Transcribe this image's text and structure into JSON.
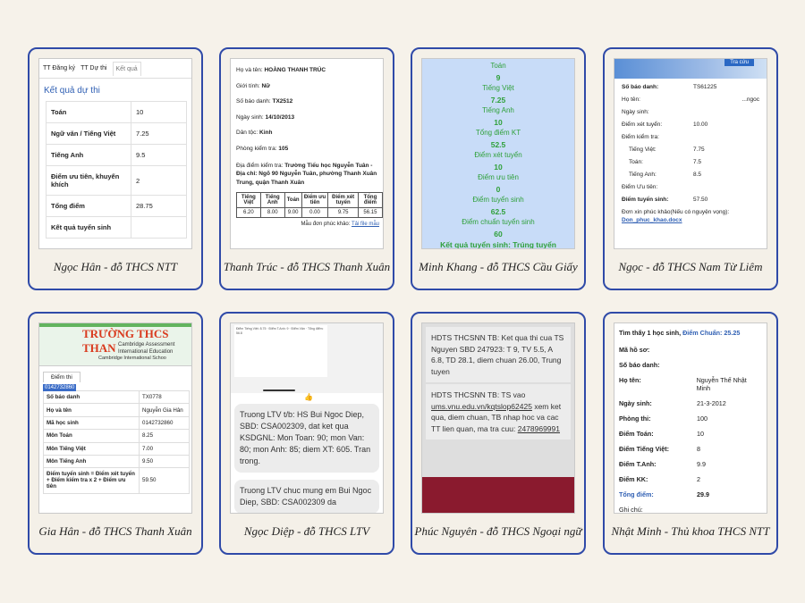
{
  "cards": [
    {
      "caption": "Ngọc Hân - đỗ THCS NTT",
      "tabs": [
        "TT Đăng ký",
        "TT Dự thi",
        "Kết quả"
      ],
      "title": "Kết quả dự thi",
      "rows": [
        {
          "label": "Toán",
          "value": "10"
        },
        {
          "label": "Ngữ văn / Tiếng Việt",
          "value": "7.25"
        },
        {
          "label": "Tiếng Anh",
          "value": "9.5"
        },
        {
          "label": "Điểm ưu tiên, khuyến khích",
          "value": "2"
        },
        {
          "label": "Tổng điểm",
          "value": "28.75"
        },
        {
          "label": "Kết quả tuyển sinh",
          "value": ""
        }
      ]
    },
    {
      "caption": "Thanh Trúc - đỗ THCS Thanh Xuân",
      "lines": [
        {
          "label": "Họ và tên:",
          "value": "HOÀNG THANH TRÚC"
        },
        {
          "label": "Giới tính:",
          "value": "Nữ"
        },
        {
          "label": "Số báo danh:",
          "value": "TX2512"
        },
        {
          "label": "Ngày sinh:",
          "value": "14/10/2013"
        },
        {
          "label": "Dân tộc:",
          "value": "Kinh"
        },
        {
          "label": "Phòng kiểm tra:",
          "value": "105"
        }
      ],
      "address_label": "Địa điểm kiểm tra:",
      "address_value": "Trường Tiểu học Nguyễn Tuân - Địa chỉ: Ngõ 90 Nguyễn Tuân, phường Thanh Xuân Trung, quận Thanh Xuân",
      "table_headers": [
        "Tiếng Việt",
        "Tiếng Anh",
        "Toán",
        "Điểm ưu tiên",
        "Điểm xét tuyển",
        "Tổng điểm"
      ],
      "table_values": [
        "6.20",
        "8.00",
        "9.00",
        "0.00",
        "9.75",
        "56.15"
      ],
      "note_label": "Mẫu đơn phúc khảo:",
      "note_link": "Tải file mẫu"
    },
    {
      "caption": "Minh Khang - đỗ THCS Cầu Giấy",
      "items": [
        {
          "label": "Toán",
          "value": "9"
        },
        {
          "label": "Tiếng Việt",
          "value": "7.25"
        },
        {
          "label": "Tiếng Anh",
          "value": "10"
        },
        {
          "label": "Tổng điểm KT",
          "value": "52.5"
        },
        {
          "label": "Điểm xét tuyển",
          "value": "10"
        },
        {
          "label": "Điểm ưu tiên",
          "value": "0"
        },
        {
          "label": "Điểm tuyển sinh",
          "value": "62.5"
        },
        {
          "label": "Điểm chuẩn tuyển sinh",
          "value": "60"
        }
      ],
      "result": "Kết quả tuyển sinh: Trúng tuyển"
    },
    {
      "caption": "Ngọc - đỗ THCS Nam Từ Liêm",
      "header_button": "Tra cứu",
      "sbd_label": "Số báo danh:",
      "sbd_value": "TS61225",
      "name_label": "Họ tên:",
      "name_value": "...ngoc",
      "dob_label": "Ngày sinh:",
      "xet_label": "Điểm xét tuyển:",
      "xet_value": "10.00",
      "kt_label": "Điểm kiểm tra:",
      "sub_rows": [
        {
          "label": "Tiếng Việt:",
          "value": "7.75"
        },
        {
          "label": "Toán:",
          "value": "7.5"
        },
        {
          "label": "Tiếng Anh:",
          "value": "8.5"
        }
      ],
      "ut_label": "Điểm Ưu tiên:",
      "ts_label": "Điểm tuyển sinh:",
      "ts_value": "57.50",
      "form_label": "Đơn xin phúc khảo(Nếu có nguyện vọng):",
      "form_link": "Don_phuc_khao.docx"
    },
    {
      "caption": "Gia Hân - đỗ THCS Thanh Xuân",
      "school_name": "TRƯỜNG THCS THAN",
      "cambridge1": "Cambridge Assessment",
      "cambridge2": "International Education",
      "cambridge3": "Cambridge International Schoo",
      "tab": "Điểm thi",
      "code": "0142732860",
      "rows": [
        {
          "label": "Số báo danh",
          "value": "TX0778"
        },
        {
          "label": "Họ và tên",
          "value": "Nguyễn Gia Hân"
        },
        {
          "label": "Mã học sinh",
          "value": "0142732860"
        },
        {
          "label": "Môn Toán",
          "value": "8.25"
        },
        {
          "label": "Môn Tiếng Việt",
          "value": "7.00"
        },
        {
          "label": "Môn Tiếng Anh",
          "value": "9.50"
        },
        {
          "label": "Điểm tuyển sinh = Điểm xét tuyển + Điểm kiểm tra x 2 + Điểm ưu tiên",
          "value": "59.50"
        }
      ]
    },
    {
      "caption": "Ngọc Diệp - đỗ THCS LTV",
      "mini_text": "Điểm Tiếng Việt: 8.75 · Điểm T.Anh: 9 · Điểm Văn · Tổng điểm: 56.8",
      "msg1": "Truong LTV t/b: HS Bui Ngoc Diep, SBD: CSA002309, dat ket qua KSDGNL: Mon Toan: 90; mon Van: 80; mon Anh: 85; diem XT: 605. Tran trong.",
      "msg2": "Truong LTV chuc mung em Bui Ngoc Diep, SBD: CSA002309 da"
    },
    {
      "caption": "Phúc Nguyên - đỗ THCS Ngoại ngữ",
      "msg1": "HDTS THCSNN TB: Ket qua thi cua TS Nguyen SBD 247923: T 9, TV 5.5, A 6.8, TD 28.1, diem chuan 26.00, Trung tuyen",
      "msg2_pre": "HDTS THCSNN TB: TS vao",
      "msg2_link": "ums.vnu.edu.vn/kqtslop62425",
      "msg2_post": "xem ket qua, diem chuan, TB nhap hoc va cac TT lien quan, ma tra cuu:",
      "msg2_code": "2478969991"
    },
    {
      "caption": "Nhật Minh - Thủ khoa THCS NTT",
      "top_text": "Tìm thấy 1 học sinh,",
      "top_chuan": "Điểm Chuẩn: 25.25",
      "rows": [
        {
          "label": "Mã hồ sơ:",
          "value": ""
        },
        {
          "label": "Số báo danh:",
          "value": ""
        },
        {
          "label": "Họ tên:",
          "value": "Nguyễn Thế Nhật Minh"
        },
        {
          "label": "Ngày sinh:",
          "value": "21-3-2012"
        },
        {
          "label": "Phòng thi:",
          "value": "100"
        },
        {
          "label": "Điểm Toán:",
          "value": "10"
        },
        {
          "label": "Điểm Tiếng Việt:",
          "value": "8"
        },
        {
          "label": "Điểm T.Anh:",
          "value": "9.9"
        },
        {
          "label": "Điểm KK:",
          "value": "2"
        }
      ],
      "total_label": "Tổng điểm:",
      "total_value": "29.9",
      "note_label": "Ghi chú:"
    }
  ]
}
